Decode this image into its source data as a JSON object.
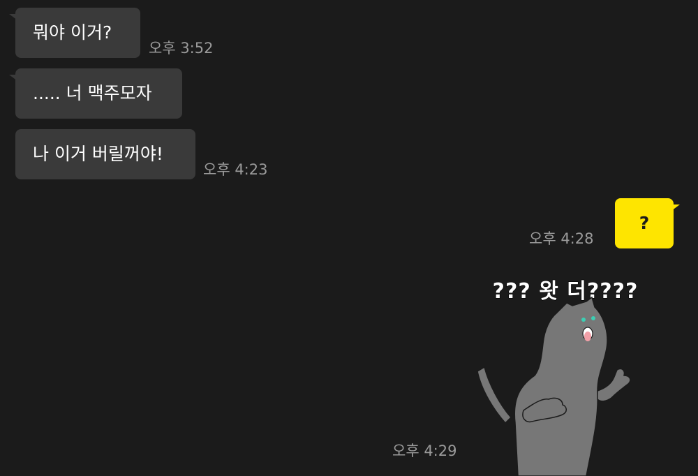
{
  "messages": [
    {
      "text": "뭐야 이거?",
      "time": "오후 3:52"
    },
    {
      "text": "..... 너 맥주모자"
    },
    {
      "text": "나 이거 버릴꺼야!",
      "time": "오후 4:23"
    },
    {
      "text": "?",
      "time": "오후 4:28"
    },
    {
      "sticker_caption": "??? 왓 더????",
      "sticker_icon": "confused-cat-sticker",
      "time": "오후 4:29"
    }
  ],
  "colors": {
    "background": "#1b1b1b",
    "incoming_bubble": "#3a3a3a",
    "outgoing_bubble": "#fee500",
    "timestamp": "#9b9b9b"
  }
}
